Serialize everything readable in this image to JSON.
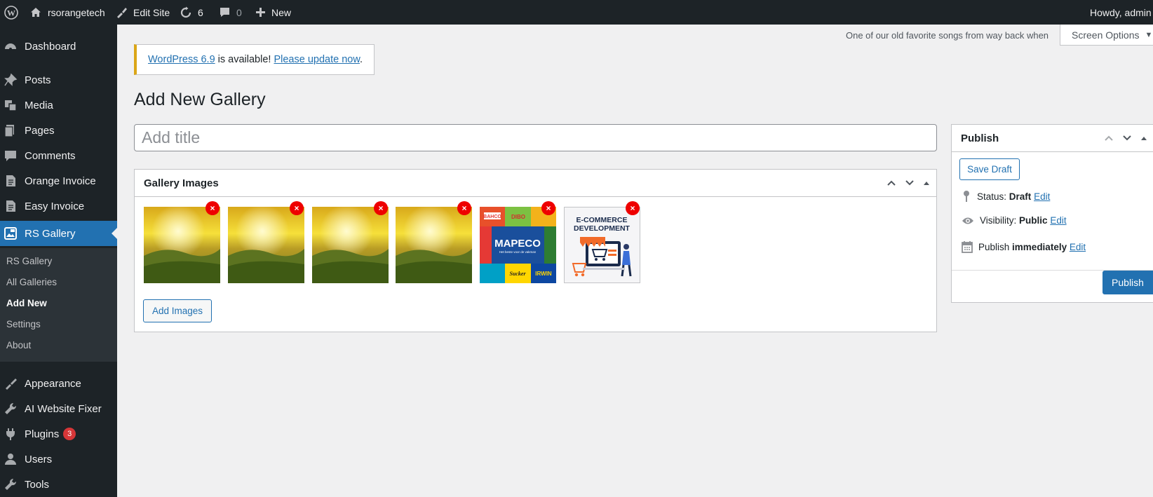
{
  "adminbar": {
    "site_name": "rsorangetech",
    "edit_site": "Edit Site",
    "updates_count": "6",
    "comments_count": "0",
    "new_label": "New",
    "howdy": "Howdy, admin"
  },
  "menu": {
    "dashboard": "Dashboard",
    "posts": "Posts",
    "media": "Media",
    "pages": "Pages",
    "comments": "Comments",
    "orange_invoice": "Orange Invoice",
    "easy_invoice": "Easy Invoice",
    "rs_gallery": "RS Gallery",
    "appearance": "Appearance",
    "ai_fixer": "AI Website Fixer",
    "plugins": "Plugins",
    "plugins_badge": "3",
    "users": "Users",
    "tools": "Tools",
    "submenu": {
      "rs_gallery": "RS Gallery",
      "all_galleries": "All Galleries",
      "add_new": "Add New",
      "settings": "Settings",
      "about": "About"
    }
  },
  "header": {
    "dolly": "One of our old favorite songs from way back when",
    "screen_options": "Screen Options"
  },
  "notice": {
    "link1": "WordPress 6.9",
    "text": " is available! ",
    "link2": "Please update now",
    "end": "."
  },
  "page_title": "Add New Gallery",
  "title_placeholder": "Add title",
  "gallery": {
    "title": "Gallery Images",
    "add_button": "Add Images",
    "remove_symbol": "×",
    "images": [
      {
        "kind": "landscape"
      },
      {
        "kind": "landscape"
      },
      {
        "kind": "landscape"
      },
      {
        "kind": "landscape"
      },
      {
        "kind": "mapeco",
        "center_text": "MAPECO",
        "sub_text": "Het beste voor de vakman",
        "logos": [
          "BAHCO",
          "DIBO",
          "Sucker",
          "IRWIN"
        ]
      },
      {
        "kind": "ecommerce",
        "line1": "E-COMMERCE",
        "line2": "DEVELOPMENT"
      }
    ]
  },
  "publish": {
    "title": "Publish",
    "save_draft": "Save Draft",
    "status_label": "Status:",
    "status_value": "Draft",
    "visibility_label": "Visibility:",
    "visibility_value": "Public",
    "publish_label": "Publish",
    "publish_value": "immediately",
    "edit": "Edit",
    "publish_button": "Publish"
  },
  "colors": {
    "admin_dark": "#1d2327",
    "accent_blue": "#2271b1",
    "notice_yellow": "#dba617",
    "remove_red": "#ee0000"
  }
}
